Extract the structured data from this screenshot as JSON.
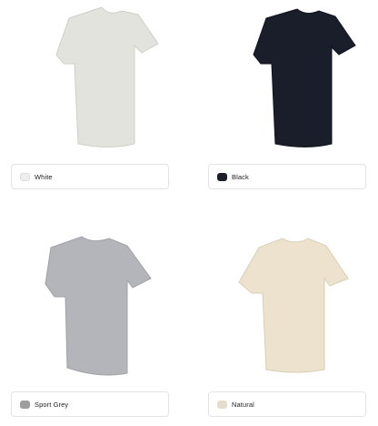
{
  "products": [
    {
      "color_name": "White",
      "swatch": "#eeeeee",
      "shirt_fill": "#e3e3de",
      "shirt_stroke": "#cfcfc8"
    },
    {
      "color_name": "Black",
      "swatch": "#1b1f2a",
      "shirt_fill": "#1a1e2b",
      "shirt_stroke": "#11141c"
    },
    {
      "color_name": "Sport Grey",
      "swatch": "#9e9e9e",
      "shirt_fill": "#b4b4bb",
      "shirt_stroke": "#a0a0a8"
    },
    {
      "color_name": "Natural",
      "swatch": "#e6dccb",
      "shirt_fill": "#ece2cd",
      "shirt_stroke": "#d9ceb6"
    }
  ]
}
